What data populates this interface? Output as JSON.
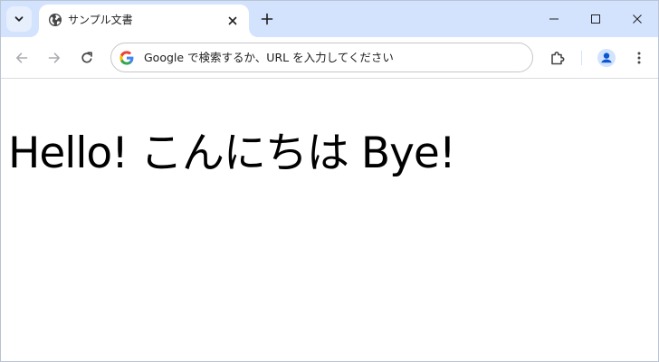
{
  "tab": {
    "title": "サンプル文書",
    "favicon_icon": "globe-icon",
    "close_icon": "close-icon"
  },
  "tabstrip": {
    "search_icon": "chevron-down-icon",
    "new_tab_icon": "plus-icon"
  },
  "window_controls": {
    "minimize_icon": "minimize-icon",
    "maximize_icon": "maximize-icon",
    "close_icon": "close-icon"
  },
  "toolbar": {
    "back_icon": "arrow-left-icon",
    "forward_icon": "arrow-right-icon",
    "reload_icon": "reload-icon",
    "extensions_icon": "puzzle-icon",
    "profile_icon": "avatar-icon",
    "menu_icon": "kebab-menu-icon"
  },
  "omnibox": {
    "placeholder": "Google で検索するか、URL を入力してください",
    "value": ""
  },
  "page": {
    "heading": "Hello! こんにちは Bye!"
  },
  "colors": {
    "tabstrip_bg": "#d3e3fd",
    "profile_accent": "#0b57d0"
  }
}
